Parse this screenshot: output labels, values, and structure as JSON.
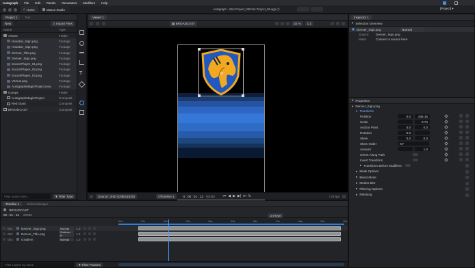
{
  "menubar": {
    "app": "Autograph",
    "items": [
      "File",
      "Edit",
      "Panels",
      "Generators",
      "Modifiers",
      "Help"
    ],
    "title": "Autograph - Intro Project_05/Intro Project_05.agp (*)",
    "project_menu": "[Project] ▾"
  },
  "tabs": {
    "home": "Home",
    "maxon": "Maxon Studio"
  },
  "project_panel": {
    "tab": "Project 1",
    "tab2": "Text",
    "new_label": "New",
    "import_label": "Import Files",
    "col_name": "Name",
    "col_type": "Type",
    "items": [
      {
        "name": "Assets",
        "type": "Folder",
        "indent": 0,
        "kind": "folder"
      },
      {
        "name": "Houston_Sign.png",
        "type": "Footage",
        "indent": 1,
        "kind": "file"
      },
      {
        "name": "Houston_Sign.png",
        "type": "Footage",
        "indent": 1,
        "kind": "file"
      },
      {
        "name": "Denver_Title.png",
        "type": "Footage",
        "indent": 1,
        "kind": "file"
      },
      {
        "name": "Denver_Sign.png",
        "type": "Footage",
        "indent": 1,
        "kind": "file"
      },
      {
        "name": "SoccerPlayer_01.png",
        "type": "Footage",
        "indent": 1,
        "kind": "file"
      },
      {
        "name": "SoccerPlayer_02.png",
        "type": "Footage",
        "indent": 1,
        "kind": "file"
      },
      {
        "name": "SoccerPlayer_03.png",
        "type": "Footage",
        "indent": 1,
        "kind": "file"
      },
      {
        "name": "Versus.png",
        "type": "Footage",
        "indent": 1,
        "kind": "file"
      },
      {
        "name": "AutographMagicProject.mov",
        "type": "Footage",
        "indent": 1,
        "kind": "file"
      },
      {
        "name": "Comps",
        "type": "Folder",
        "indent": 0,
        "kind": "folder"
      },
      {
        "name": "AutographMagicProject",
        "type": "Composit",
        "indent": 1,
        "kind": "comp"
      },
      {
        "name": "Red Giant",
        "type": "Composit",
        "indent": 1,
        "kind": "comp"
      },
      {
        "name": "BROADCAST",
        "type": "Composit",
        "indent": 0,
        "kind": "comp"
      }
    ],
    "filter_placeholder": "Filter project item...",
    "filter_type": "Filter Type"
  },
  "viewer": {
    "tab": "Viewer 1",
    "comp_label": "BROADCAST",
    "zoom": "32 %",
    "ratio": "1:1",
    "source": "Source: VHD (1080x1920)",
    "timeline_select": "Timeline 1",
    "timecode": "0 : 00 : 01 : 12",
    "fps": "/ 24 fps",
    "frame": "00036"
  },
  "inspector": {
    "tab": "Inspector 1",
    "overview_title": "Selection Overview",
    "layer_name": "Denver_Sign.png",
    "blend": "Normal",
    "source_label": "Source",
    "source_value": "Denver_Sign.png",
    "mask_label": "Mask",
    "mask_value": "Connect a source here",
    "properties_title": "Properties",
    "prop_layer": "Denver_Sign.png",
    "transform": "Transform",
    "props": [
      {
        "label": "Position",
        "v1": "0.0",
        "v2": "435.15"
      },
      {
        "label": "Scale",
        "v1": "",
        "v2": "0.74"
      },
      {
        "label": "Anchor Point",
        "v1": "0.0",
        "v2": "0.0"
      },
      {
        "label": "Rotation",
        "v1": "0.0",
        "v2": ""
      },
      {
        "label": "Skew",
        "v1": "0.0",
        "v2": "0.0"
      },
      {
        "label": "Skew Order",
        "v1": "XY",
        "v2": ""
      },
      {
        "label": "Amount",
        "v1": "",
        "v2": "1.0"
      },
      {
        "label": "Orient Along Path",
        "v1": "",
        "v2": ""
      },
      {
        "label": "Invert Transform",
        "v1": "",
        "v2": ""
      }
    ],
    "sections": [
      "Transform Before Modifiers",
      "Mask Options",
      "Blend Mode",
      "Motion Blur",
      "Filtering Options",
      "Retiming"
    ]
  },
  "timeline": {
    "tab": "Timeline 1",
    "tab2": "Global Manager",
    "comp": "BROADCAST",
    "timecode": "00 : 01 : 12",
    "frame": "00036",
    "unitype": "UniType",
    "ruler": [
      "00s",
      "01s",
      "02s",
      "03s",
      "04s",
      "05s",
      "06s",
      "07s",
      "08s",
      "09s",
      "10s"
    ],
    "layers": [
      {
        "num": "001",
        "name": "Denver_Sign.png",
        "mode": "Normal",
        "val": "1.0"
      },
      {
        "num": "002",
        "name": "Denver_Title.png",
        "mode": "Subtract R",
        "val": "1.0"
      },
      {
        "num": "003",
        "name": "Gradient",
        "mode": "Normal",
        "val": "1.0"
      }
    ],
    "filter_placeholder": "Filter Layers by name",
    "filter_params": "Filter Params"
  },
  "colors": {
    "accent": "#2f7fd6",
    "track": "#8f9294",
    "playhead": "#4a9cff"
  }
}
